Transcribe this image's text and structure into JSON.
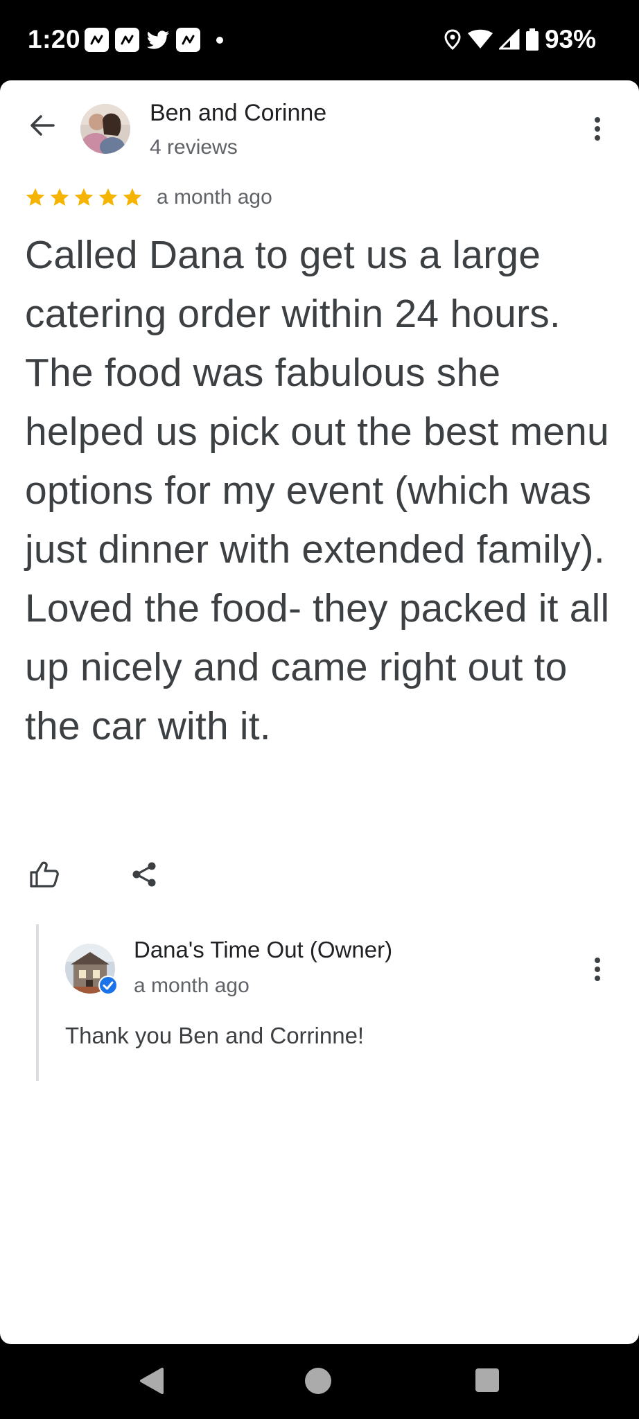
{
  "status_bar": {
    "time": "1:20",
    "battery": "93%",
    "notification_icons": [
      "app-icon",
      "app-icon",
      "twitter-icon",
      "app-icon"
    ]
  },
  "review": {
    "reviewer_name": "Ben and Corinne",
    "review_count": "4 reviews",
    "rating": 5,
    "rating_max": 5,
    "date": "a month ago",
    "text": "Called Dana to get us a large catering order within 24 hours. The food was fabulous she helped us pick out the best menu options for my event (which was just dinner with extended family). Loved the food- they packed it all up nicely and came right out to the car with it."
  },
  "actions": {
    "like_icon": "thumbs-up-icon",
    "share_icon": "share-icon"
  },
  "owner_reply": {
    "name": "Dana's Time Out (Owner)",
    "date": "a month ago",
    "text": "Thank you Ben and Corrinne!"
  },
  "colors": {
    "star": "#f4b400",
    "verified": "#1a73e8",
    "primary_text": "#202124",
    "secondary_text": "#5f6368"
  }
}
